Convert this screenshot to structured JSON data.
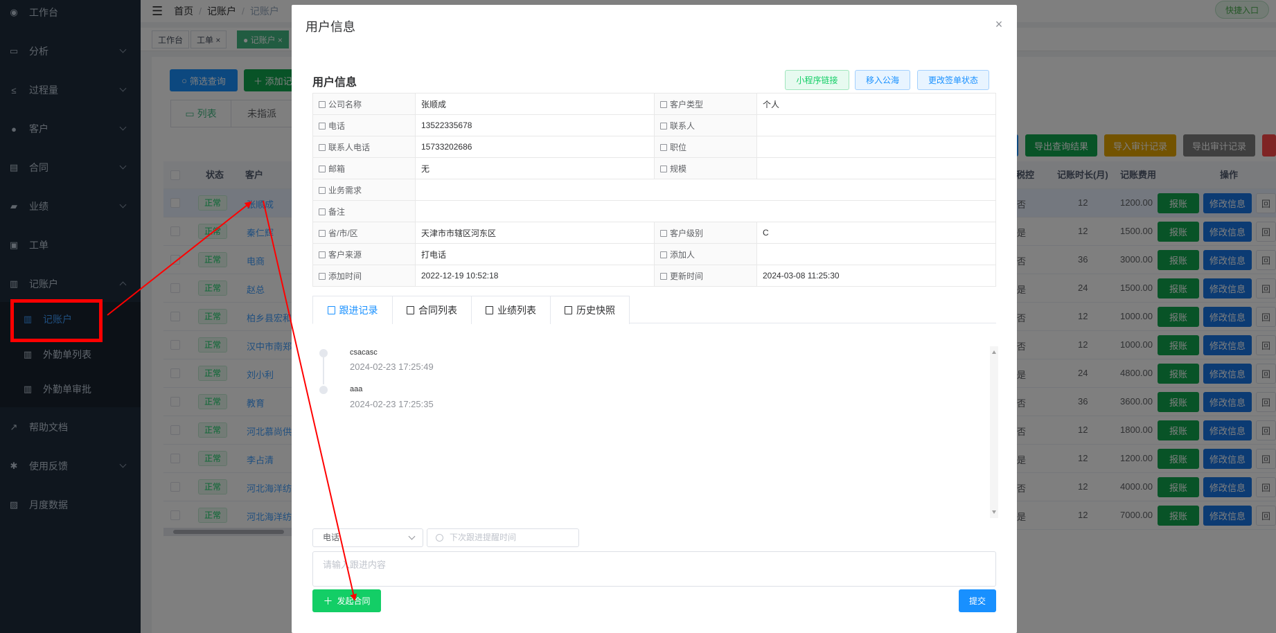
{
  "sidebar": {
    "items": [
      {
        "label": "工作台",
        "icon": "dashboard-icon"
      },
      {
        "label": "分析",
        "icon": "chart-icon"
      },
      {
        "label": "过程量",
        "icon": "process-icon"
      },
      {
        "label": "客户",
        "icon": "user-icon"
      },
      {
        "label": "合同",
        "icon": "document-icon"
      },
      {
        "label": "业绩",
        "icon": "briefcase-icon"
      },
      {
        "label": "工单",
        "icon": "clipboard-icon"
      },
      {
        "label": "记账户",
        "icon": "book-icon"
      },
      {
        "label": "帮助文档",
        "icon": "external-link-icon"
      },
      {
        "label": "使用反馈",
        "icon": "bug-icon"
      },
      {
        "label": "月度数据",
        "icon": "chart-box-icon"
      }
    ],
    "subitems": [
      {
        "label": "记账户",
        "icon": "book-icon"
      },
      {
        "label": "外勤单列表",
        "icon": "book-icon"
      },
      {
        "label": "外勤单审批",
        "icon": "book-icon"
      }
    ]
  },
  "topbar": {
    "breadcrumb": [
      "首页",
      "记账户",
      "记账户"
    ],
    "quick_entry": "快捷入口"
  },
  "tags": [
    {
      "label": "工作台"
    },
    {
      "label": "工单 ×"
    },
    {
      "label": "● 记账户 ×"
    }
  ],
  "toolbar": {
    "filter_label": "筛选查询",
    "add_label": "＋ 添加记",
    "export_query_label": "导出查询结果",
    "import_audit_label": "导入审计记录",
    "export_audit_label": "导出审计记录"
  },
  "subtabs": {
    "list": "列表",
    "unassigned": "未指派"
  },
  "table": {
    "headers": {
      "status": "状态",
      "customer": "客户",
      "tax": "税控",
      "duration": "记账时长(月)",
      "fee": "记账费用",
      "ops": "操作"
    },
    "rows": [
      {
        "status": "正常",
        "customer": "张顺成",
        "tax": "否",
        "duration": "12",
        "fee": "1200.00"
      },
      {
        "status": "正常",
        "customer": "秦仁辉",
        "tax": "是",
        "duration": "12",
        "fee": "1500.00"
      },
      {
        "status": "正常",
        "customer": "电商",
        "tax": "否",
        "duration": "36",
        "fee": "3000.00"
      },
      {
        "status": "正常",
        "customer": "赵总",
        "tax": "是",
        "duration": "24",
        "fee": "1500.00"
      },
      {
        "status": "正常",
        "customer": "柏乡县宏和",
        "tax": "否",
        "duration": "12",
        "fee": "1000.00"
      },
      {
        "status": "正常",
        "customer": "汉中市南郑区",
        "tax": "否",
        "duration": "12",
        "fee": "1000.00"
      },
      {
        "status": "正常",
        "customer": "刘小利",
        "tax": "是",
        "duration": "24",
        "fee": "4800.00"
      },
      {
        "status": "正常",
        "customer": "教育",
        "tax": "否",
        "duration": "36",
        "fee": "3600.00"
      },
      {
        "status": "正常",
        "customer": "河北慕尚供应",
        "tax": "否",
        "duration": "12",
        "fee": "1800.00"
      },
      {
        "status": "正常",
        "customer": "李占清",
        "tax": "是",
        "duration": "12",
        "fee": "1200.00"
      },
      {
        "status": "正常",
        "customer": "河北海洋纺织",
        "tax": "否",
        "duration": "12",
        "fee": "4000.00"
      },
      {
        "status": "正常",
        "customer": "河北海洋纺织",
        "tax": "是",
        "duration": "12",
        "fee": "7000.00"
      }
    ],
    "op_report": "报账",
    "op_edit": "修改信息"
  },
  "modal": {
    "title": "用户信息",
    "close": "×",
    "section_title": "用户信息",
    "btn_mini": "小程序链接",
    "btn_pool": "移入公海",
    "btn_sign": "更改签单状态",
    "info": {
      "company_label": "公司名称",
      "company": "张顺成",
      "type_label": "客户类型",
      "type": "个人",
      "phone_label": "电话",
      "phone": "13522335678",
      "contact_label": "联系人",
      "contact": "",
      "contact_phone_label": "联系人电话",
      "contact_phone": "15733202686",
      "position_label": "职位",
      "position": "",
      "email_label": "邮箱",
      "email": "无",
      "scale_label": "规模",
      "scale": "",
      "demand_label": "业务需求",
      "demand": "",
      "remark_label": "备注",
      "remark": "",
      "region_label": "省/市/区",
      "region": "天津市市辖区河东区",
      "level_label": "客户级别",
      "level": "C",
      "source_label": "客户来源",
      "source": "打电话",
      "adder_label": "添加人",
      "adder": "",
      "add_time_label": "添加时间",
      "add_time": "2022-12-19 10:52:18",
      "update_time_label": "更新时间",
      "update_time": "2024-03-08 11:25:30"
    },
    "tabs": [
      "跟进记录",
      "合同列表",
      "业绩列表",
      "历史快照"
    ],
    "timeline": [
      {
        "content": "csacasc",
        "time": "2024-02-23 17:25:49"
      },
      {
        "content": "aaa",
        "time": "2024-02-23 17:25:35"
      }
    ],
    "method_value": "电话",
    "next_time_placeholder": "下次跟进提醒时间",
    "content_placeholder": "请输入跟进内容",
    "send_contract": "发起合同",
    "submit": "提交"
  },
  "colors": {
    "accent": "#1890ff",
    "success": "#13ce66",
    "annotation": "#ff0000",
    "sidebar_bg": "#1f2d3d"
  }
}
